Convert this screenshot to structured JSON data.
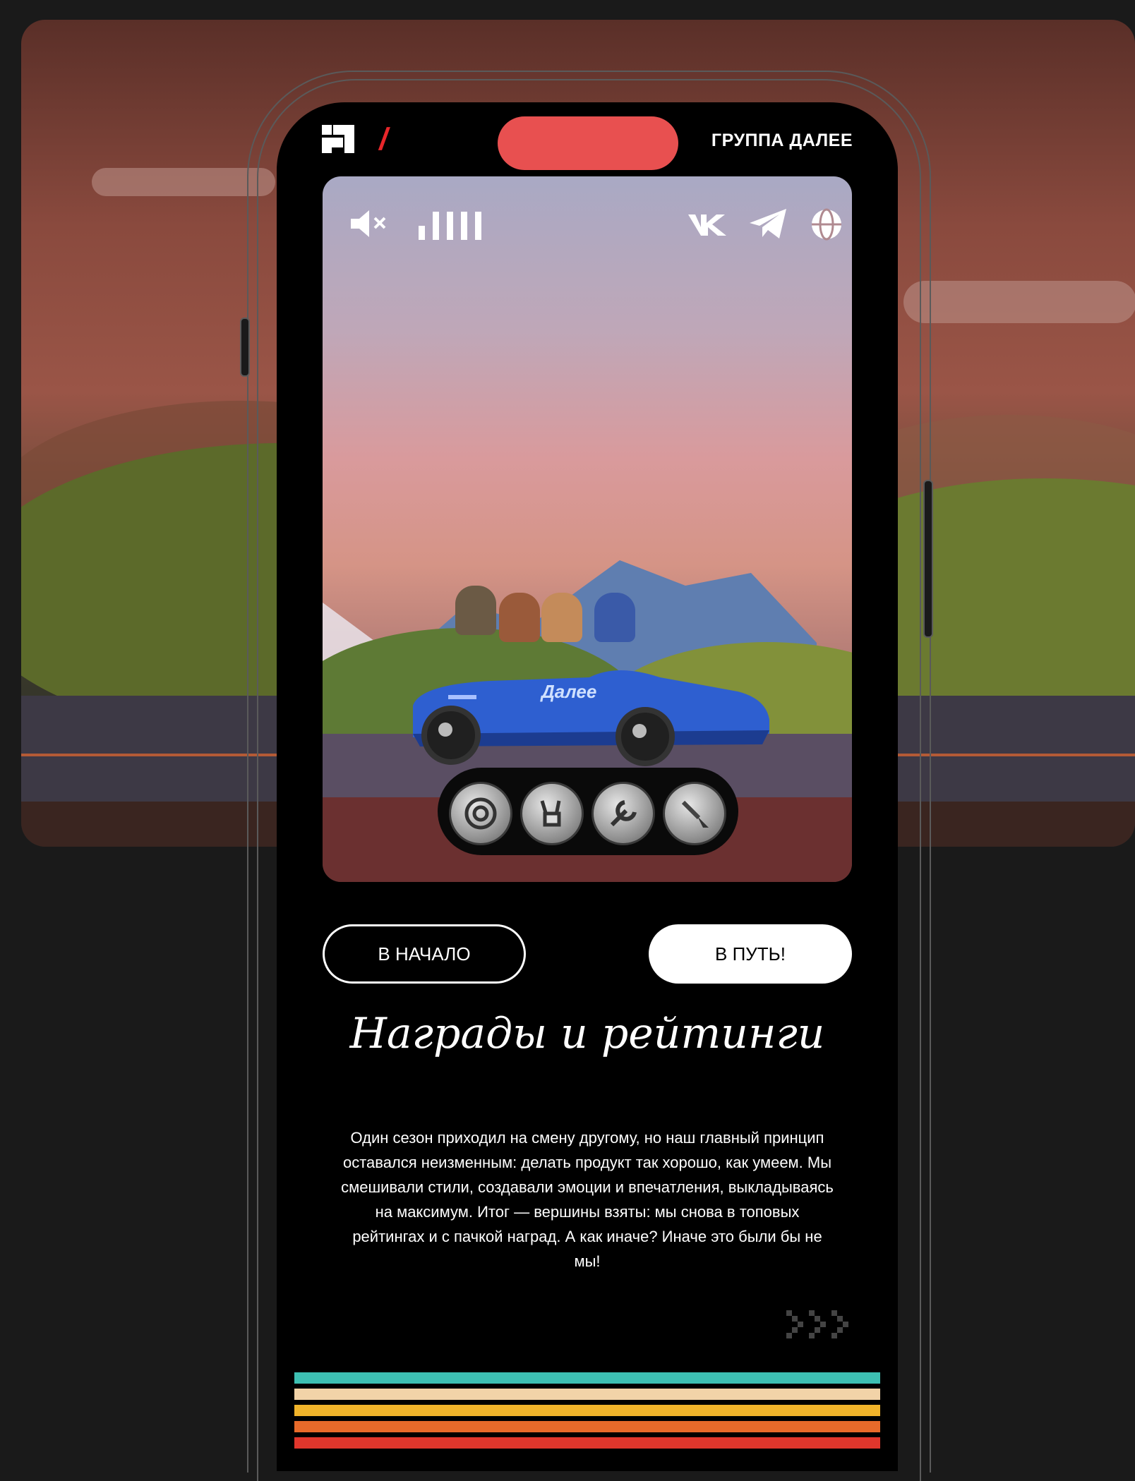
{
  "header": {
    "brand": "ГРУППА ДАЛЕЕ",
    "logo_icon": "magwai-logo-icon",
    "slash_color": "#e8262a"
  },
  "hero": {
    "toolbar_left": [
      "mute-icon",
      "volume-bars-icon"
    ],
    "toolbar_right": [
      "vk-icon",
      "telegram-icon",
      "globe-icon"
    ],
    "car_label": "Далее",
    "badges": [
      "target-icon",
      "rock-hand-icon",
      "wrench-icon",
      "brush-icon"
    ]
  },
  "buttons": {
    "start": "В НАЧАЛО",
    "go": "В ПУТЬ!"
  },
  "section": {
    "title": "Награды и рейтинги",
    "body": "Один сезон приходил на смену другому, но наш главный принцип оставался неизменным: делать продукт так хорошо, как умеем. Мы смешивали стили, создавали эмоции и впечатления, выкладываясь на максимум. Итог — вершины взяты: мы снова в топовых рейтингах и с пачкой наград. А как иначе? Иначе это были бы не мы!",
    "next_icon": "next-arrows-icon"
  },
  "stripes": [
    "#3dbfb2",
    "#f2d3a8",
    "#f0b32a",
    "#e76a2a",
    "#e0362c"
  ]
}
